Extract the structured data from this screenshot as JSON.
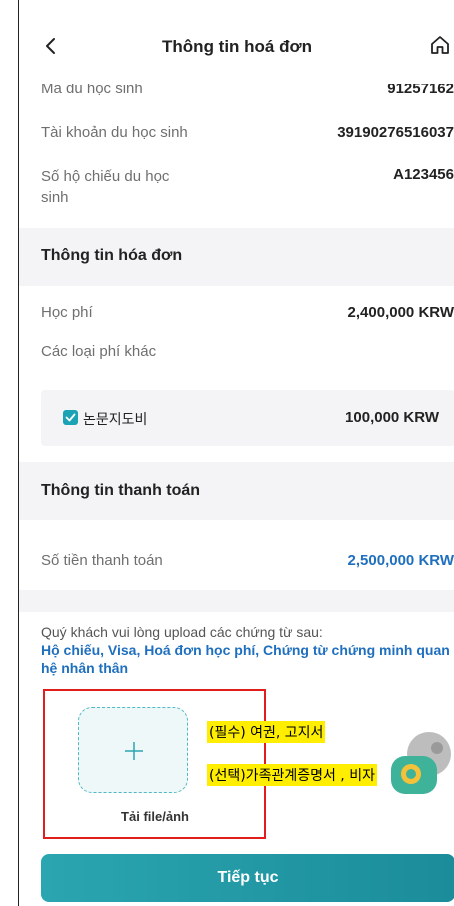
{
  "header": {
    "title": "Thông tin hoá đơn"
  },
  "student": {
    "rows": [
      {
        "label": "Mã du học sinh",
        "value": "91257162"
      },
      {
        "label": "Tài khoản du học sinh",
        "value": "39190276516037"
      },
      {
        "label": "Số hộ chiếu du học sinh",
        "value": "A123456"
      }
    ]
  },
  "invoice": {
    "section_title": "Thông tin hóa đơn",
    "tuition_label": "Học phí",
    "tuition_value": "2,400,000 KRW",
    "other_fees_label": "Các loại phí khác",
    "other_fee_item_label": "논문지도비",
    "other_fee_item_value": "100,000 KRW",
    "other_fee_item_checked": true
  },
  "payment": {
    "section_title": "Thông tin thanh toán",
    "amount_label": "Số tiền thanh toán",
    "amount_value": "2,500,000 KRW"
  },
  "upload": {
    "instruction": "Quý khách vui lòng upload các chứng từ sau:",
    "documents": "Hộ chiếu, Visa, Hoá đơn học phí, Chứng từ chứng minh quan hệ nhân thân",
    "tile_label": "Tải file/ảnh"
  },
  "annotations": {
    "required": "(필수) 여권, 고지서",
    "optional": "(선택)가족관계증명서 , 비자"
  },
  "footer": {
    "continue_label": "Tiếp tục"
  },
  "colors": {
    "accent": "#1aa3b5",
    "link_blue": "#1f6fbf",
    "highlight": "#ffee00",
    "annotation_border": "#e01e1e"
  }
}
